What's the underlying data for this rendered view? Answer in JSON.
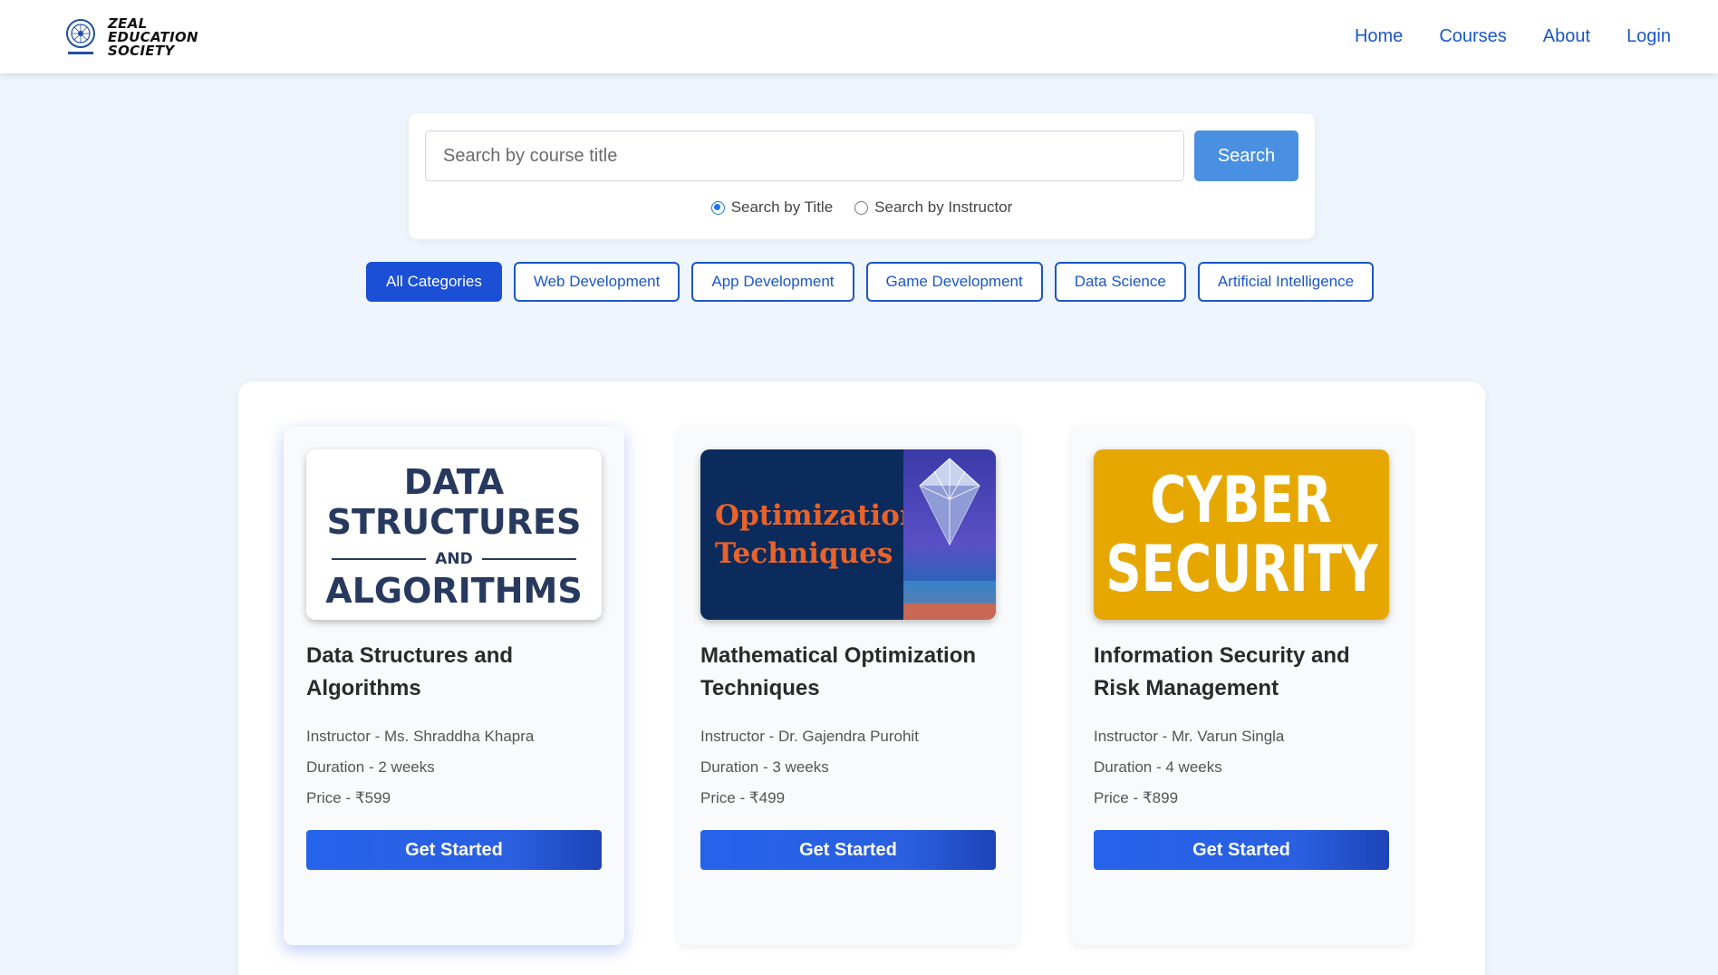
{
  "header": {
    "logo_lines": [
      "ZEAL",
      "EDUCATION",
      "SOCIETY"
    ],
    "nav": [
      "Home",
      "Courses",
      "About",
      "Login"
    ]
  },
  "search": {
    "placeholder": "Search by course title",
    "button_label": "Search",
    "radio_title": "Search by Title",
    "radio_instructor": "Search by Instructor",
    "selected": "title"
  },
  "categories": [
    "All Categories",
    "Web Development",
    "App Development",
    "Game Development",
    "Data Science",
    "Artificial Intelligence"
  ],
  "active_category": "All Categories",
  "courses": [
    {
      "title": "Data Structures and Algorithms",
      "instructor": "Instructor - Ms. Shraddha Khapra",
      "duration": "Duration - 2 weeks",
      "price": "Price - ₹599",
      "cta": "Get Started",
      "image_text": [
        "DATA",
        "STRUCTURES",
        "AND",
        "ALGORITHMS"
      ]
    },
    {
      "title": "Mathematical Optimization Techniques",
      "instructor": "Instructor - Dr. Gajendra Purohit",
      "duration": "Duration - 3 weeks",
      "price": "Price - ₹499",
      "cta": "Get Started",
      "image_text": [
        "Optimization",
        "Techniques"
      ]
    },
    {
      "title": "Information Security and Risk Management",
      "instructor": "Instructor - Mr. Varun Singla",
      "duration": "Duration - 4 weeks",
      "price": "Price - ₹899",
      "cta": "Get Started",
      "image_text": [
        "CYBER",
        "SECURITY"
      ]
    }
  ],
  "colors": {
    "accent": "#1a56c8",
    "search_button": "#4a90e2",
    "page_bg": "#eef5fc",
    "cyber_bg": "#e6a800",
    "opt_bg": "#0b2b5c"
  }
}
